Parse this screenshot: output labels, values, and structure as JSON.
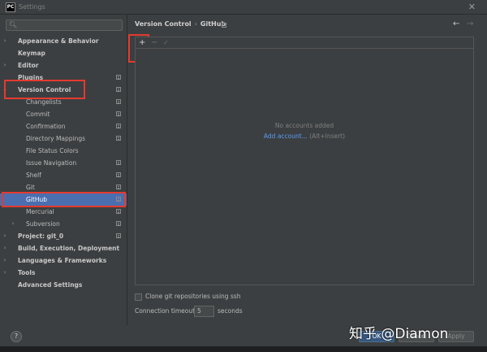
{
  "window": {
    "title": "Settings",
    "app_icon_text": "PC",
    "close_icon": "close-icon"
  },
  "search": {
    "placeholder": "",
    "icon": "search-icon"
  },
  "sidebar": {
    "items": [
      {
        "label": "Appearance & Behavior",
        "level": 0,
        "arrow": "›",
        "bold": true,
        "badge": false
      },
      {
        "label": "Keymap",
        "level": 0,
        "arrow": "",
        "bold": true,
        "badge": false
      },
      {
        "label": "Editor",
        "level": 0,
        "arrow": "›",
        "bold": true,
        "badge": false
      },
      {
        "label": "Plugins",
        "level": 0,
        "arrow": "",
        "bold": true,
        "badge": true
      },
      {
        "label": "Version Control",
        "level": 0,
        "arrow": "⌄",
        "bold": true,
        "badge": true
      },
      {
        "label": "Changelists",
        "level": 1,
        "arrow": "",
        "bold": false,
        "badge": true
      },
      {
        "label": "Commit",
        "level": 1,
        "arrow": "",
        "bold": false,
        "badge": true
      },
      {
        "label": "Confirmation",
        "level": 1,
        "arrow": "",
        "bold": false,
        "badge": true
      },
      {
        "label": "Directory Mappings",
        "level": 1,
        "arrow": "",
        "bold": false,
        "badge": true
      },
      {
        "label": "File Status Colors",
        "level": 1,
        "arrow": "",
        "bold": false,
        "badge": false
      },
      {
        "label": "Issue Navigation",
        "level": 1,
        "arrow": "",
        "bold": false,
        "badge": true
      },
      {
        "label": "Shelf",
        "level": 1,
        "arrow": "",
        "bold": false,
        "badge": true
      },
      {
        "label": "Git",
        "level": 1,
        "arrow": "",
        "bold": false,
        "badge": true
      },
      {
        "label": "GitHub",
        "level": 1,
        "arrow": "",
        "bold": false,
        "badge": true,
        "selected": true
      },
      {
        "label": "Mercurial",
        "level": 1,
        "arrow": "",
        "bold": false,
        "badge": true
      },
      {
        "label": "Subversion",
        "level": 1,
        "arrow": "›",
        "bold": false,
        "badge": true
      },
      {
        "label": "Project: git_0",
        "level": 0,
        "arrow": "›",
        "bold": true,
        "badge": true
      },
      {
        "label": "Build, Execution, Deployment",
        "level": 0,
        "arrow": "›",
        "bold": true,
        "badge": false
      },
      {
        "label": "Languages & Frameworks",
        "level": 0,
        "arrow": "›",
        "bold": true,
        "badge": false
      },
      {
        "label": "Tools",
        "level": 0,
        "arrow": "›",
        "bold": true,
        "badge": false
      },
      {
        "label": "Advanced Settings",
        "level": 0,
        "arrow": "",
        "bold": true,
        "badge": false
      }
    ]
  },
  "breadcrumb": {
    "parent": "Version Control",
    "separator": "›",
    "current": "GitHub"
  },
  "nav": {
    "back": "←",
    "forward": "→"
  },
  "toolbar": {
    "add": "+",
    "remove": "−",
    "check": "✓"
  },
  "accounts": {
    "empty_text": "No accounts added",
    "add_link": "Add account...",
    "add_hint": "(Alt+Insert)"
  },
  "options": {
    "clone_ssh_label": "Clone git repositories using ssh",
    "timeout_label": "Connection timeout:",
    "timeout_value": "5",
    "timeout_unit": "seconds"
  },
  "footer": {
    "help": "?",
    "ok": "OK",
    "cancel": "Cancel",
    "apply": "Apply"
  },
  "watermark": "知乎 @Diamon",
  "colors": {
    "background": "#3c3f41",
    "selection": "#4b6eaf",
    "link": "#589df6",
    "highlight": "#e53a2f"
  }
}
